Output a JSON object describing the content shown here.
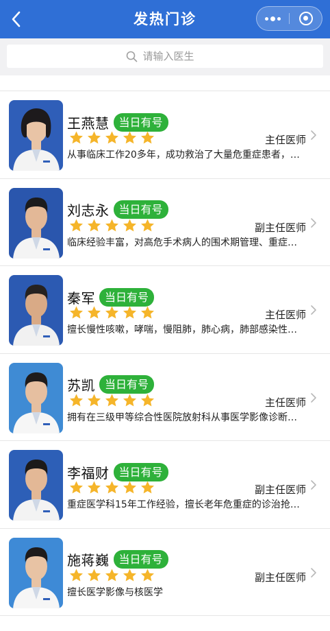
{
  "header": {
    "title": "发热门诊",
    "back_icon": "chevron-left-icon",
    "more_icon": "more-dots-icon",
    "close_icon": "target-close-icon",
    "background": "#2f6fd6"
  },
  "search": {
    "placeholder": "请输入医生",
    "icon": "search-icon"
  },
  "colors": {
    "badge": "#2eb13a",
    "star": "#f5b52a",
    "header": "#2f6fd6"
  },
  "doctors": [
    {
      "name": "王燕慧",
      "badge": "当日有号",
      "rating": 5,
      "title": "主任医师",
      "desc": "从事临床工作20多年，成功救治了大量危重症患者，…",
      "avatar": {
        "bg": "#2f5eb8",
        "skin": "#e9c4a6",
        "hair": "#1d1a1c",
        "coat": "#f3f3f3",
        "female": true
      }
    },
    {
      "name": "刘志永",
      "badge": "当日有号",
      "rating": 5,
      "title": "副主任医师",
      "desc": "临床经验丰富，对高危手术病人的围术期管理、重症…",
      "avatar": {
        "bg": "#2a56ad",
        "skin": "#e3b897",
        "hair": "#1b1b1d",
        "coat": "#f4f4f4",
        "female": false
      }
    },
    {
      "name": "秦军",
      "badge": "当日有号",
      "rating": 5,
      "title": "主任医师",
      "desc": "擅长慢性咳嗽，哮喘，慢阻肺，肺心病，肺部感染性…",
      "avatar": {
        "bg": "#2c5ab2",
        "skin": "#d9aa86",
        "hair": "#262220",
        "coat": "#f1f1f1",
        "female": false
      }
    },
    {
      "name": "苏凯",
      "badge": "当日有号",
      "rating": 5,
      "title": "主任医师",
      "desc": "拥有在三级甲等综合性医院放射科从事医学影像诊断…",
      "avatar": {
        "bg": "#3f8bd4",
        "skin": "#e6bfa0",
        "hair": "#1f1c1c",
        "coat": "#f6f6f6",
        "female": false
      }
    },
    {
      "name": "李福财",
      "badge": "当日有号",
      "rating": 5,
      "title": "副主任医师",
      "desc": "重症医学科15年工作经验，擅长老年危重症的诊治抢…",
      "avatar": {
        "bg": "#2d5fb7",
        "skin": "#e3b896",
        "hair": "#1c1a1a",
        "coat": "#f3f3f3",
        "female": false
      }
    },
    {
      "name": "施蒋巍",
      "badge": "当日有号",
      "rating": 5,
      "title": "副主任医师",
      "desc": "擅长医学影像与核医学",
      "avatar": {
        "bg": "#3e8ad6",
        "skin": "#e8c3a4",
        "hair": "#1e1b1b",
        "coat": "#f6f6f6",
        "female": false
      }
    }
  ]
}
